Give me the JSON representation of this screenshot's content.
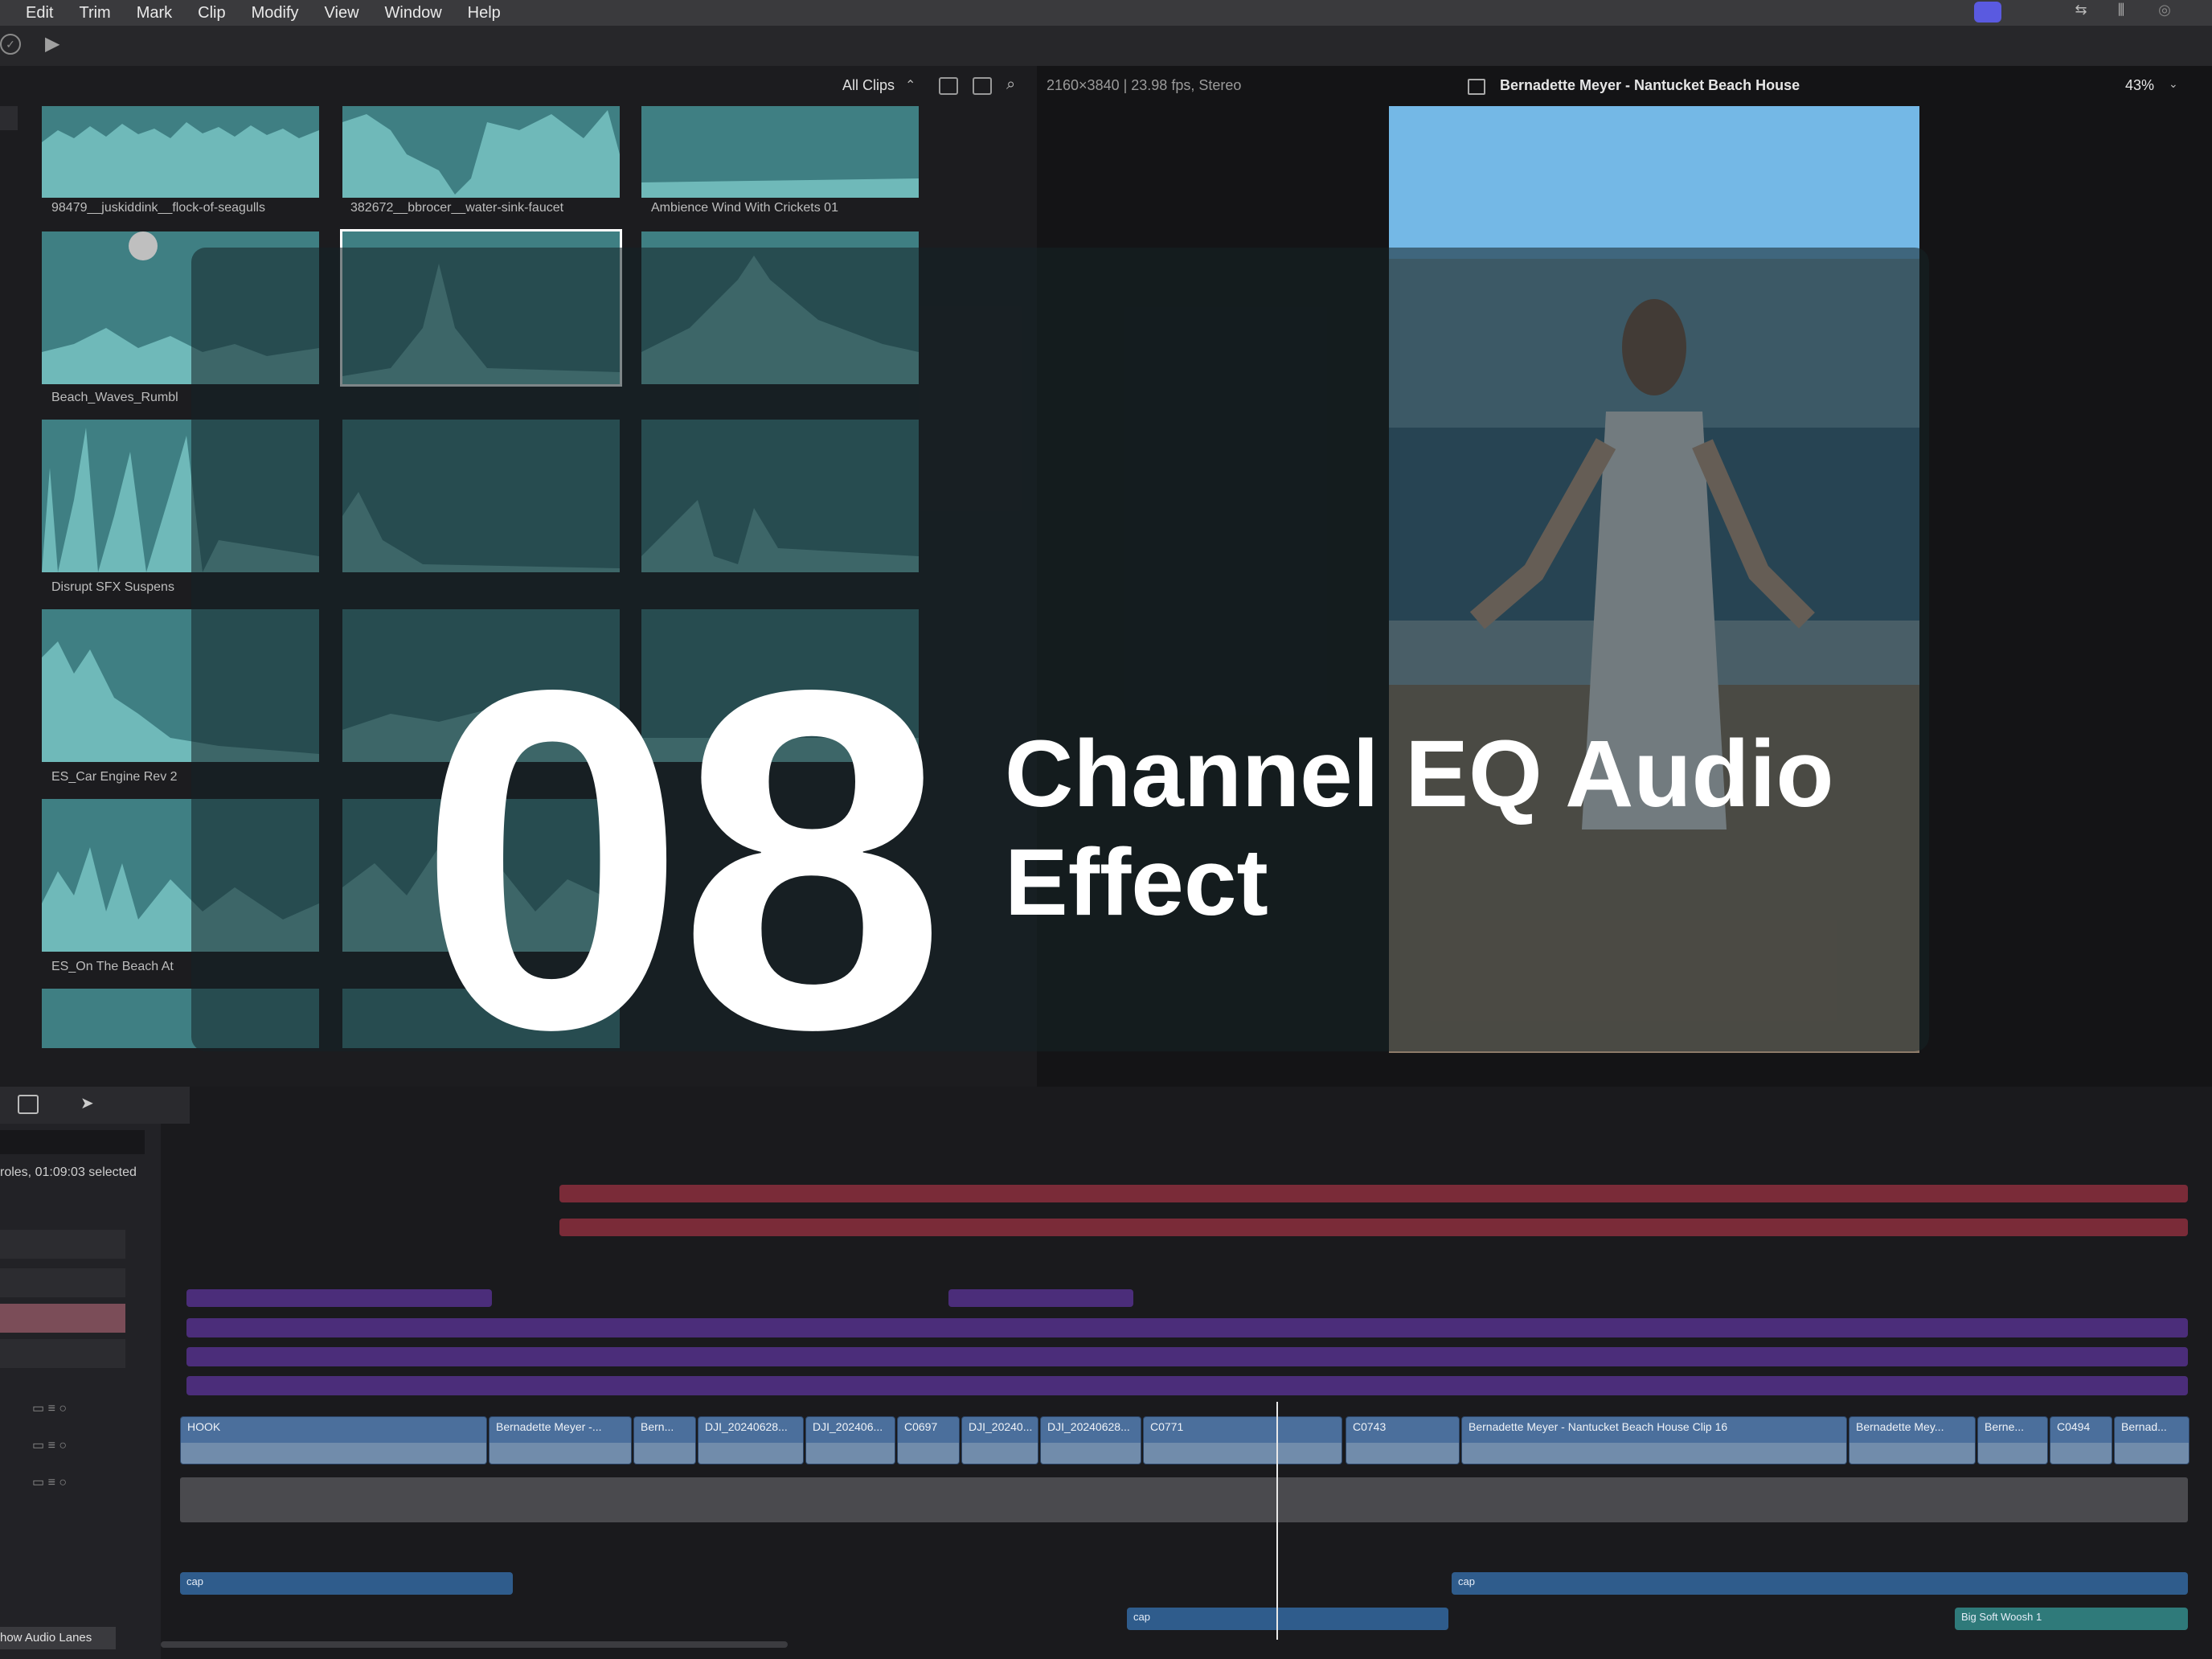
{
  "menu": {
    "items": [
      "Edit",
      "Trim",
      "Mark",
      "Clip",
      "Modify",
      "View",
      "Window",
      "Help"
    ]
  },
  "browser": {
    "filter_label": "All Clips",
    "filter_chevron": "⌃",
    "clips": [
      {
        "label": "98479__juskiddink__flock-of-seagulls"
      },
      {
        "label": "382672__bbrocer__water-sink-faucet"
      },
      {
        "label": "Ambience Wind With Crickets 01"
      },
      {
        "label": "Beach_Waves_Rumbl"
      },
      {
        "label": ""
      },
      {
        "label": ""
      },
      {
        "label": ""
      },
      {
        "label": ""
      },
      {
        "label": "Disrupt SFX Suspens"
      },
      {
        "label": "ES_Car Engine Rev 2"
      },
      {
        "label": "ES_On The Beach At"
      }
    ]
  },
  "viewer": {
    "format_info": "2160×3840 | 23.98 fps, Stereo",
    "project_title": "Bernadette Meyer - Nantucket Beach House",
    "zoom": "43%"
  },
  "timeline": {
    "selection_info": "roles, 01:09:03 selected",
    "show_audio_lanes": "how Audio Lanes",
    "clips": [
      {
        "label": "HOOK"
      },
      {
        "label": "Bernadette Meyer -..."
      },
      {
        "label": "Bern..."
      },
      {
        "label": "DJI_20240628..."
      },
      {
        "label": "DJI_202406..."
      },
      {
        "label": "C0697"
      },
      {
        "label": "DJI_20240..."
      },
      {
        "label": "DJI_20240628..."
      },
      {
        "label": "C0771"
      },
      {
        "label": "C0743"
      },
      {
        "label": "Bernadette Meyer - Nantucket Beach House Clip 16"
      },
      {
        "label": "Bernadette Mey..."
      },
      {
        "label": "Berne..."
      },
      {
        "label": "C0494"
      },
      {
        "label": "Bernad..."
      }
    ],
    "audio_clips": [
      {
        "label": "cap"
      },
      {
        "label": "cap"
      },
      {
        "label": "cap"
      },
      {
        "label": "Big Soft Woosh 1"
      }
    ]
  },
  "overlay": {
    "number": "08",
    "title_line1": "Channel EQ Audio",
    "title_line2": "Effect"
  },
  "colors": {
    "waveform_bg": "#3f7f83",
    "waveform_fill": "#6fb9b9",
    "clip_blue": "#4b6f9c",
    "role_purple": "#4b2d7a",
    "role_red": "#7a2b38"
  }
}
